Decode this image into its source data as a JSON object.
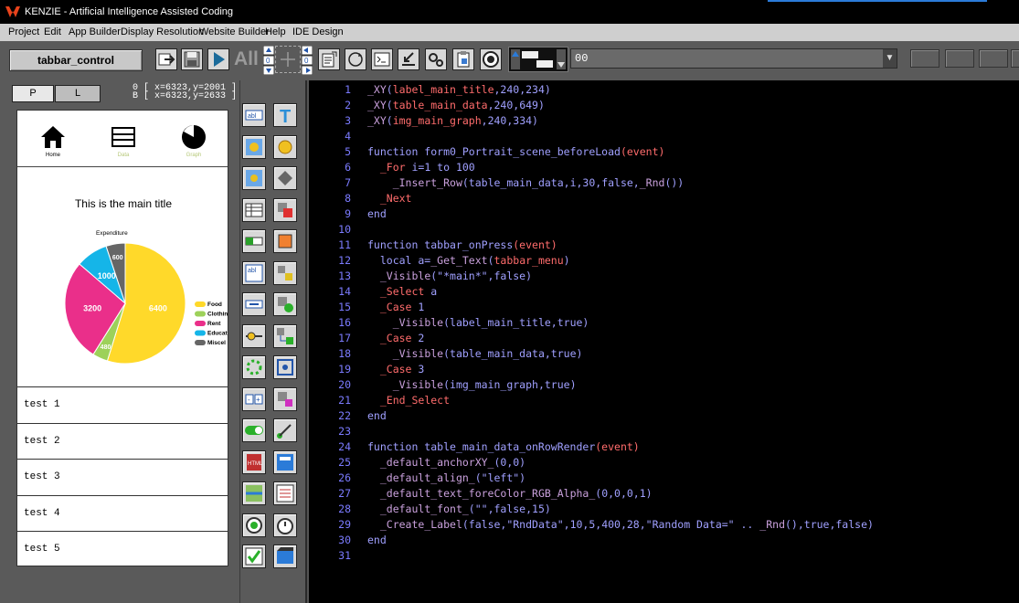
{
  "window": {
    "title": "KENZIE - Artificial Intelligence Assisted Coding"
  },
  "menu": [
    "Project",
    "Edit",
    "App Builder",
    "Display Resolution",
    "Website Builder",
    "Help",
    "IDE Design"
  ],
  "toolbar": {
    "object_name": "tabbar_control",
    "all_label": "All",
    "status_value": "00"
  },
  "preview": {
    "tabs": [
      "P",
      "L"
    ],
    "coords": [
      "0 [ x=6323,y=2001 ]",
      "B [ x=6323,y=2633 ]"
    ],
    "tabbar": [
      {
        "label": "Home",
        "icon": "home-icon"
      },
      {
        "label": "Data",
        "icon": "list-icon"
      },
      {
        "label": "Graph",
        "icon": "pie-icon"
      }
    ],
    "main_title": "This is the main title",
    "graph": {
      "title": "Expenditure",
      "slices": [
        {
          "label": "Food",
          "value": 6400,
          "color": "#ffd92a"
        },
        {
          "label": "Clothing",
          "value": 480,
          "color": "#9dd15a"
        },
        {
          "label": "Rent",
          "value": 3200,
          "color": "#ea2f8a"
        },
        {
          "label": "Education",
          "value": 1000,
          "color": "#15b5e8"
        },
        {
          "label": "Miscellaneous",
          "value": 600,
          "color": "#666666"
        }
      ],
      "legend_visible": [
        "Food",
        "Clothin",
        "Rent",
        "Educat",
        "Miscel"
      ]
    },
    "rows": [
      "test 1",
      "test 2",
      "test 3",
      "test 4",
      "test 5"
    ]
  },
  "palette_icons": [
    "textbox-icon",
    "text-icon",
    "image-icon",
    "button-icon",
    "image-gear-icon",
    "shape-icon",
    "table-icon",
    "shape-red-icon",
    "progress-icon",
    "sprite-icon",
    "textarea-icon",
    "shape-small-icon",
    "input-icon",
    "shape-green-icon",
    "slider-icon",
    "flow-icon",
    "spinner-icon",
    "joint-icon",
    "stepper-icon",
    "shape-pink-icon",
    "toggle-icon",
    "path-icon",
    "html-icon",
    "web-icon",
    "map-icon",
    "list-icon",
    "radio-icon",
    "timer-icon",
    "checkbox-icon",
    "video-icon"
  ],
  "code_lines": [
    [
      [
        "_XY",
        "fn"
      ],
      [
        "(",
        "kw"
      ],
      [
        "label_main_title",
        "id"
      ],
      [
        ",240,234)",
        "kw"
      ]
    ],
    [
      [
        "_XY",
        "fn"
      ],
      [
        "(",
        "kw"
      ],
      [
        "table_main_data",
        "id"
      ],
      [
        ",240,649)",
        "kw"
      ]
    ],
    [
      [
        "_XY",
        "fn"
      ],
      [
        "(",
        "kw"
      ],
      [
        "img_main_graph",
        "id"
      ],
      [
        ",240,334)",
        "kw"
      ]
    ],
    [],
    [
      [
        "function form0_Portrait_scene_beforeLoad",
        "kw"
      ],
      [
        "(event)",
        "id"
      ]
    ],
    [
      [
        "  ",
        "kw"
      ],
      [
        "_For",
        "id"
      ],
      [
        " i=1 to 100",
        "kw"
      ]
    ],
    [
      [
        "    ",
        "kw"
      ],
      [
        "_Insert_Row",
        "fn"
      ],
      [
        "(table_main_data,i,30,false,",
        "kw"
      ],
      [
        "_Rnd",
        "fn"
      ],
      [
        "())",
        "kw"
      ]
    ],
    [
      [
        "  ",
        "kw"
      ],
      [
        "_Next",
        "id"
      ]
    ],
    [
      [
        "end",
        "kw"
      ]
    ],
    [],
    [
      [
        "function tabbar_onPress",
        "kw"
      ],
      [
        "(event)",
        "id"
      ]
    ],
    [
      [
        "  local a=",
        "kw"
      ],
      [
        "_Get_Text",
        "fn"
      ],
      [
        "(",
        "kw"
      ],
      [
        "tabbar_menu",
        "id"
      ],
      [
        ")",
        "kw"
      ]
    ],
    [
      [
        "  ",
        "kw"
      ],
      [
        "_Visible",
        "fn"
      ],
      [
        "(\"*main*\",false)",
        "kw"
      ]
    ],
    [
      [
        "  ",
        "kw"
      ],
      [
        "_Select",
        "id"
      ],
      [
        " a",
        "kw"
      ]
    ],
    [
      [
        "  ",
        "kw"
      ],
      [
        "_Case",
        "id"
      ],
      [
        " 1",
        "kw"
      ]
    ],
    [
      [
        "    ",
        "kw"
      ],
      [
        "_Visible",
        "fn"
      ],
      [
        "(label_main_title,true)",
        "kw"
      ]
    ],
    [
      [
        "  ",
        "kw"
      ],
      [
        "_Case",
        "id"
      ],
      [
        " 2",
        "kw"
      ]
    ],
    [
      [
        "    ",
        "kw"
      ],
      [
        "_Visible",
        "fn"
      ],
      [
        "(table_main_data,true)",
        "kw"
      ]
    ],
    [
      [
        "  ",
        "kw"
      ],
      [
        "_Case",
        "id"
      ],
      [
        " 3",
        "kw"
      ]
    ],
    [
      [
        "    ",
        "kw"
      ],
      [
        "_Visible",
        "fn"
      ],
      [
        "(img_main_graph,true)",
        "kw"
      ]
    ],
    [
      [
        "  ",
        "kw"
      ],
      [
        "_End_Select",
        "id"
      ]
    ],
    [
      [
        "end",
        "kw"
      ]
    ],
    [],
    [
      [
        "function table_main_data_onRowRender",
        "kw"
      ],
      [
        "(event)",
        "id"
      ]
    ],
    [
      [
        "  ",
        "kw"
      ],
      [
        "_default_anchorXY_",
        "fn"
      ],
      [
        "(0,0)",
        "kw"
      ]
    ],
    [
      [
        "  ",
        "kw"
      ],
      [
        "_default_align_",
        "fn"
      ],
      [
        "(\"left\")",
        "kw"
      ]
    ],
    [
      [
        "  ",
        "kw"
      ],
      [
        "_default_text_foreColor_RGB_Alpha_",
        "fn"
      ],
      [
        "(0,0,0,1)",
        "kw"
      ]
    ],
    [
      [
        "  ",
        "kw"
      ],
      [
        "_default_font_",
        "fn"
      ],
      [
        "(\"\",false,15)",
        "kw"
      ]
    ],
    [
      [
        "  ",
        "kw"
      ],
      [
        "_Create_Label",
        "fn"
      ],
      [
        "(false,\"RndData\",10,5,400,28,\"Random Data=\" .. ",
        "kw"
      ],
      [
        "_Rnd",
        "fn"
      ],
      [
        "(),true,false)",
        "kw"
      ]
    ],
    [
      [
        "end",
        "kw"
      ]
    ],
    []
  ]
}
